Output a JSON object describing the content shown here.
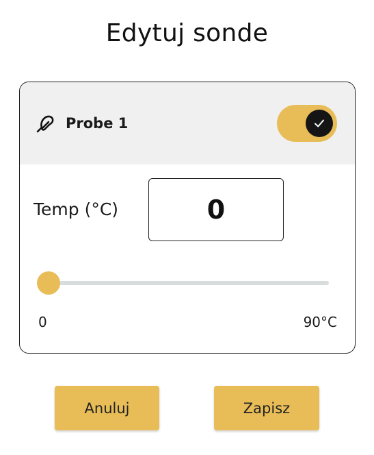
{
  "dialog": {
    "title": "Edytuj sonde"
  },
  "probe": {
    "name": "Probe 1",
    "icon": "thermometer-probe-icon",
    "enabled": true,
    "toggle_icon": "checkmark-icon"
  },
  "temperature": {
    "label": "Temp (°C)",
    "value": "0",
    "slider": {
      "min_label": "0",
      "max_label": "90°C",
      "value": 0,
      "min": 0,
      "max": 90
    }
  },
  "actions": {
    "cancel_label": "Anuluj",
    "save_label": "Zapisz"
  },
  "colors": {
    "accent": "#e8bd57",
    "header_bg": "#f0f0f0",
    "track": "#d9dcdc",
    "knob": "#151515"
  }
}
